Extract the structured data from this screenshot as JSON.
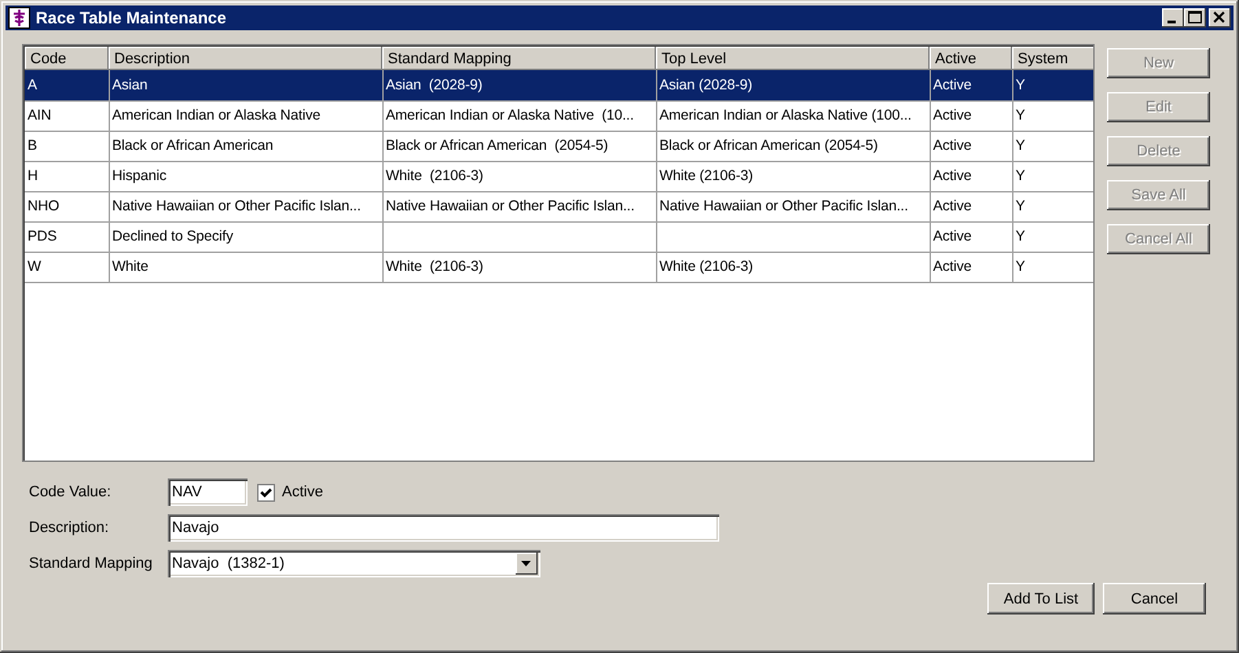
{
  "window": {
    "title": "Race Table Maintenance"
  },
  "table": {
    "columns": [
      "Code",
      "Description",
      "Standard Mapping",
      "Top Level",
      "Active",
      "System"
    ],
    "rows": [
      {
        "selected": true,
        "cells": [
          "A",
          "Asian",
          "Asian  (2028-9)",
          "Asian (2028-9)",
          "Active",
          "Y"
        ]
      },
      {
        "selected": false,
        "cells": [
          "AIN",
          "American Indian or Alaska Native",
          "American Indian or Alaska Native  (10...",
          "American Indian or Alaska Native (100...",
          "Active",
          "Y"
        ]
      },
      {
        "selected": false,
        "cells": [
          "B",
          "Black or African American",
          "Black or African American  (2054-5)",
          "Black or African American (2054-5)",
          "Active",
          "Y"
        ]
      },
      {
        "selected": false,
        "cells": [
          "H",
          "Hispanic",
          "White  (2106-3)",
          "White (2106-3)",
          "Active",
          "Y"
        ]
      },
      {
        "selected": false,
        "cells": [
          "NHO",
          "Native Hawaiian or Other Pacific Islan...",
          "Native Hawaiian or Other Pacific Islan...",
          "Native Hawaiian or Other Pacific Islan...",
          "Active",
          "Y"
        ]
      },
      {
        "selected": false,
        "cells": [
          "PDS",
          "Declined to Specify",
          "",
          "",
          "Active",
          "Y"
        ]
      },
      {
        "selected": false,
        "cells": [
          "W",
          "White",
          "White  (2106-3)",
          "White (2106-3)",
          "Active",
          "Y"
        ]
      }
    ]
  },
  "side_buttons": [
    {
      "label": "New",
      "disabled": true
    },
    {
      "label": "Edit",
      "disabled": true
    },
    {
      "label": "Delete",
      "disabled": true
    },
    {
      "label": "Save All",
      "disabled": true
    },
    {
      "label": "Cancel All",
      "disabled": true
    }
  ],
  "form": {
    "code_value": {
      "label": "Code Value:",
      "value": "NAV"
    },
    "active": {
      "label": "Active",
      "checked": true
    },
    "description": {
      "label": "Description:",
      "value": "Navajo"
    },
    "standard_mapping": {
      "label": "Standard Mapping",
      "value": "Navajo  (1382-1)"
    }
  },
  "footer_buttons": [
    {
      "label": "Add To List"
    },
    {
      "label": "Cancel"
    }
  ]
}
